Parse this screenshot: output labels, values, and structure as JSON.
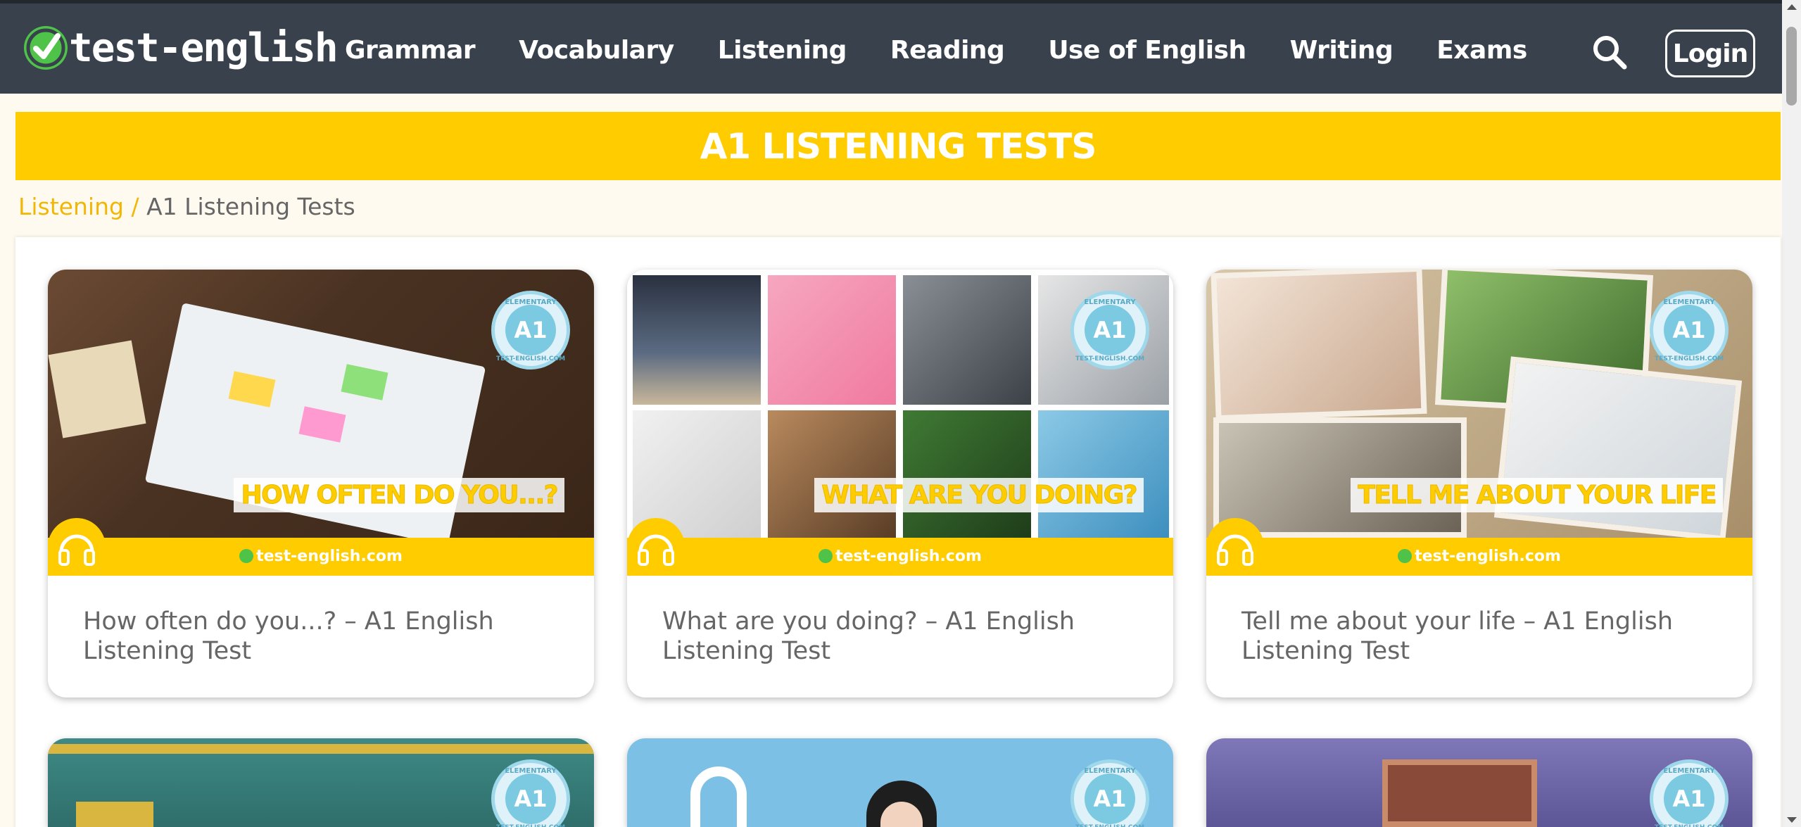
{
  "header": {
    "logo_text": "test-english",
    "nav": [
      "Grammar",
      "Vocabulary",
      "Listening",
      "Reading",
      "Use of English",
      "Writing",
      "Exams"
    ],
    "login_label": "Login",
    "search_icon": "search-icon"
  },
  "banner": {
    "title": "A1 LISTENING TESTS"
  },
  "breadcrumb": {
    "parent": "Listening",
    "separator": "/",
    "current": "A1 Listening Tests"
  },
  "badge": {
    "level": "A1",
    "top_text": "ELEMENTARY",
    "bottom_text": "TEST-ENGLISH.COM"
  },
  "strip_site": "test-english.com",
  "cards": [
    {
      "overlay": "HOW OFTEN DO YOU...?",
      "title": "How often do you...? – A1 English Listening Test"
    },
    {
      "overlay": "WHAT ARE YOU DOING?",
      "title": "What are you doing? – A1 English Listening Test"
    },
    {
      "overlay": "TELL ME ABOUT YOUR LIFE",
      "title": "Tell me about your life – A1 English Listening Test"
    }
  ],
  "colors": {
    "header_bg": "#38414c",
    "accent_yellow": "#ffcc00",
    "logo_green": "#4fc24a",
    "page_bg": "#fffaf0"
  }
}
